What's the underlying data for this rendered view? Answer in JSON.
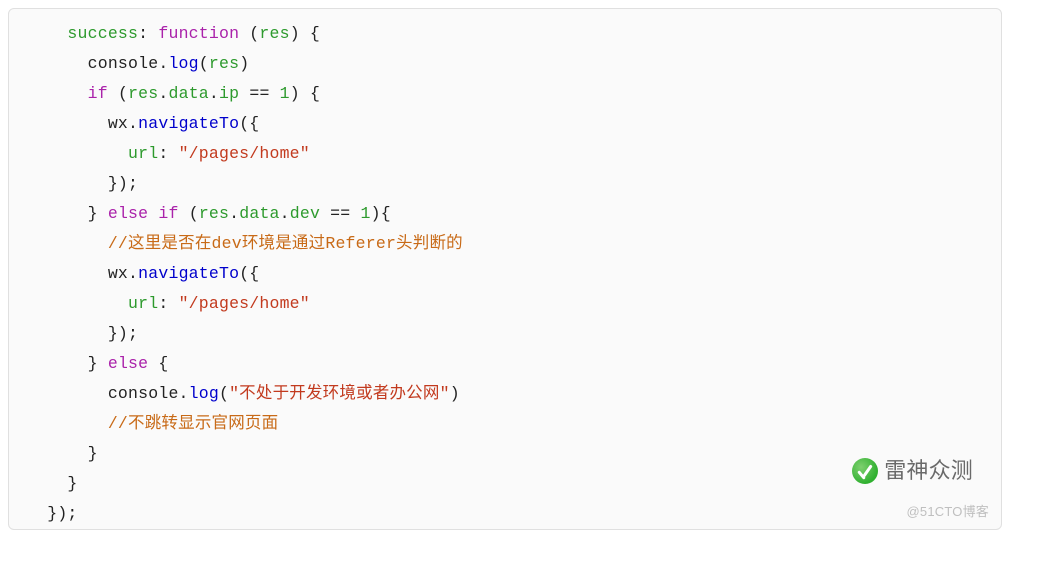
{
  "code": {
    "l1": {
      "i": "    ",
      "kw_success": "success",
      "colon": ": ",
      "kw_function": "function",
      "sp": " (",
      "arg": "res",
      "close": ") {"
    },
    "l2": {
      "i": "      ",
      "obj": "console",
      "dot": ".",
      "m": "log",
      "op": "(",
      "arg": "res",
      "cp": ")"
    },
    "l3": {
      "i": "      ",
      "kw_if": "if",
      "sp": " (",
      "v": "res",
      "d1": ".",
      "p1": "data",
      "d2": ".",
      "p2": "ip",
      "eq": " == ",
      "n": "1",
      "cp": ") {"
    },
    "l4": {
      "i": "        ",
      "obj": "wx",
      "dot": ".",
      "m": "navigateTo",
      "op": "({"
    },
    "l5": {
      "i": "          ",
      "k": "url",
      "colon": ": ",
      "s": "\"/pages/home\""
    },
    "l6": {
      "i": "        ",
      "t": "});"
    },
    "l7": {
      "i": "      ",
      "rb": "} ",
      "kw_else": "else",
      "sp1": " ",
      "kw_if": "if",
      "sp2": " (",
      "v": "res",
      "d1": ".",
      "p1": "data",
      "d2": ".",
      "p2": "dev",
      "eq": " == ",
      "n": "1",
      "cp": "){"
    },
    "l8": {
      "i": "        ",
      "c": "//这里是否在dev环境是通过Referer头判断的"
    },
    "l9": {
      "i": "        ",
      "obj": "wx",
      "dot": ".",
      "m": "navigateTo",
      "op": "({"
    },
    "l10": {
      "i": "          ",
      "k": "url",
      "colon": ": ",
      "s": "\"/pages/home\""
    },
    "l11": {
      "i": "        ",
      "t": "});"
    },
    "l12": {
      "i": "      ",
      "rb": "} ",
      "kw_else": "else",
      "sp": " {"
    },
    "l13": {
      "i": "        ",
      "obj": "console",
      "dot": ".",
      "m": "log",
      "op": "(",
      "s": "\"不处于开发环境或者办公网\"",
      "cp": ")"
    },
    "l14": {
      "i": "        ",
      "c": "//不跳转显示官网页面"
    },
    "l15": {
      "i": "      ",
      "t": "}"
    },
    "l16": {
      "i": "    ",
      "t": "}"
    },
    "l17": {
      "i": "  ",
      "t": "});"
    }
  },
  "watermark": {
    "text": "雷神众测"
  },
  "credit": "@51CTO博客"
}
